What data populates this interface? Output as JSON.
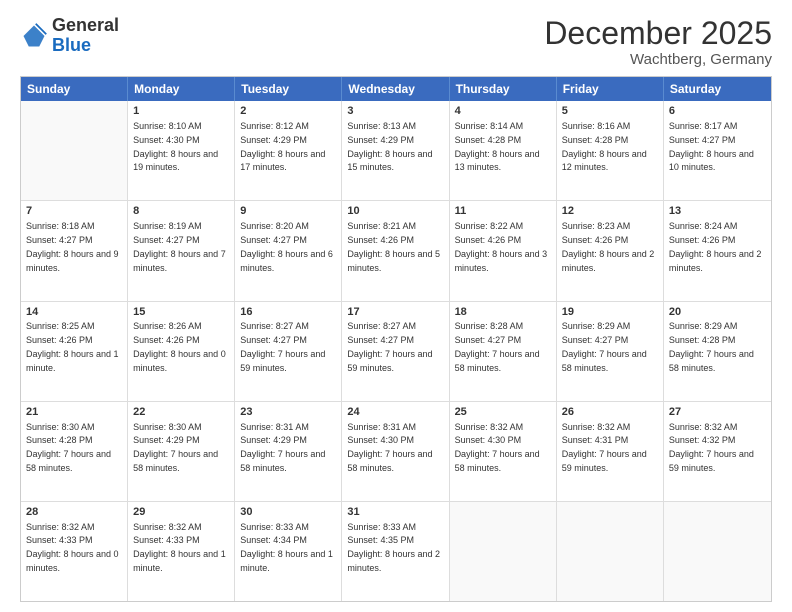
{
  "header": {
    "logo_general": "General",
    "logo_blue": "Blue",
    "month": "December 2025",
    "location": "Wachtberg, Germany"
  },
  "days_of_week": [
    "Sunday",
    "Monday",
    "Tuesday",
    "Wednesday",
    "Thursday",
    "Friday",
    "Saturday"
  ],
  "weeks": [
    [
      {
        "day": "",
        "empty": true
      },
      {
        "day": "1",
        "sunrise": "Sunrise: 8:10 AM",
        "sunset": "Sunset: 4:30 PM",
        "daylight": "Daylight: 8 hours and 19 minutes."
      },
      {
        "day": "2",
        "sunrise": "Sunrise: 8:12 AM",
        "sunset": "Sunset: 4:29 PM",
        "daylight": "Daylight: 8 hours and 17 minutes."
      },
      {
        "day": "3",
        "sunrise": "Sunrise: 8:13 AM",
        "sunset": "Sunset: 4:29 PM",
        "daylight": "Daylight: 8 hours and 15 minutes."
      },
      {
        "day": "4",
        "sunrise": "Sunrise: 8:14 AM",
        "sunset": "Sunset: 4:28 PM",
        "daylight": "Daylight: 8 hours and 13 minutes."
      },
      {
        "day": "5",
        "sunrise": "Sunrise: 8:16 AM",
        "sunset": "Sunset: 4:28 PM",
        "daylight": "Daylight: 8 hours and 12 minutes."
      },
      {
        "day": "6",
        "sunrise": "Sunrise: 8:17 AM",
        "sunset": "Sunset: 4:27 PM",
        "daylight": "Daylight: 8 hours and 10 minutes."
      }
    ],
    [
      {
        "day": "7",
        "sunrise": "Sunrise: 8:18 AM",
        "sunset": "Sunset: 4:27 PM",
        "daylight": "Daylight: 8 hours and 9 minutes."
      },
      {
        "day": "8",
        "sunrise": "Sunrise: 8:19 AM",
        "sunset": "Sunset: 4:27 PM",
        "daylight": "Daylight: 8 hours and 7 minutes."
      },
      {
        "day": "9",
        "sunrise": "Sunrise: 8:20 AM",
        "sunset": "Sunset: 4:27 PM",
        "daylight": "Daylight: 8 hours and 6 minutes."
      },
      {
        "day": "10",
        "sunrise": "Sunrise: 8:21 AM",
        "sunset": "Sunset: 4:26 PM",
        "daylight": "Daylight: 8 hours and 5 minutes."
      },
      {
        "day": "11",
        "sunrise": "Sunrise: 8:22 AM",
        "sunset": "Sunset: 4:26 PM",
        "daylight": "Daylight: 8 hours and 3 minutes."
      },
      {
        "day": "12",
        "sunrise": "Sunrise: 8:23 AM",
        "sunset": "Sunset: 4:26 PM",
        "daylight": "Daylight: 8 hours and 2 minutes."
      },
      {
        "day": "13",
        "sunrise": "Sunrise: 8:24 AM",
        "sunset": "Sunset: 4:26 PM",
        "daylight": "Daylight: 8 hours and 2 minutes."
      }
    ],
    [
      {
        "day": "14",
        "sunrise": "Sunrise: 8:25 AM",
        "sunset": "Sunset: 4:26 PM",
        "daylight": "Daylight: 8 hours and 1 minute."
      },
      {
        "day": "15",
        "sunrise": "Sunrise: 8:26 AM",
        "sunset": "Sunset: 4:26 PM",
        "daylight": "Daylight: 8 hours and 0 minutes."
      },
      {
        "day": "16",
        "sunrise": "Sunrise: 8:27 AM",
        "sunset": "Sunset: 4:27 PM",
        "daylight": "Daylight: 7 hours and 59 minutes."
      },
      {
        "day": "17",
        "sunrise": "Sunrise: 8:27 AM",
        "sunset": "Sunset: 4:27 PM",
        "daylight": "Daylight: 7 hours and 59 minutes."
      },
      {
        "day": "18",
        "sunrise": "Sunrise: 8:28 AM",
        "sunset": "Sunset: 4:27 PM",
        "daylight": "Daylight: 7 hours and 58 minutes."
      },
      {
        "day": "19",
        "sunrise": "Sunrise: 8:29 AM",
        "sunset": "Sunset: 4:27 PM",
        "daylight": "Daylight: 7 hours and 58 minutes."
      },
      {
        "day": "20",
        "sunrise": "Sunrise: 8:29 AM",
        "sunset": "Sunset: 4:28 PM",
        "daylight": "Daylight: 7 hours and 58 minutes."
      }
    ],
    [
      {
        "day": "21",
        "sunrise": "Sunrise: 8:30 AM",
        "sunset": "Sunset: 4:28 PM",
        "daylight": "Daylight: 7 hours and 58 minutes."
      },
      {
        "day": "22",
        "sunrise": "Sunrise: 8:30 AM",
        "sunset": "Sunset: 4:29 PM",
        "daylight": "Daylight: 7 hours and 58 minutes."
      },
      {
        "day": "23",
        "sunrise": "Sunrise: 8:31 AM",
        "sunset": "Sunset: 4:29 PM",
        "daylight": "Daylight: 7 hours and 58 minutes."
      },
      {
        "day": "24",
        "sunrise": "Sunrise: 8:31 AM",
        "sunset": "Sunset: 4:30 PM",
        "daylight": "Daylight: 7 hours and 58 minutes."
      },
      {
        "day": "25",
        "sunrise": "Sunrise: 8:32 AM",
        "sunset": "Sunset: 4:30 PM",
        "daylight": "Daylight: 7 hours and 58 minutes."
      },
      {
        "day": "26",
        "sunrise": "Sunrise: 8:32 AM",
        "sunset": "Sunset: 4:31 PM",
        "daylight": "Daylight: 7 hours and 59 minutes."
      },
      {
        "day": "27",
        "sunrise": "Sunrise: 8:32 AM",
        "sunset": "Sunset: 4:32 PM",
        "daylight": "Daylight: 7 hours and 59 minutes."
      }
    ],
    [
      {
        "day": "28",
        "sunrise": "Sunrise: 8:32 AM",
        "sunset": "Sunset: 4:33 PM",
        "daylight": "Daylight: 8 hours and 0 minutes."
      },
      {
        "day": "29",
        "sunrise": "Sunrise: 8:32 AM",
        "sunset": "Sunset: 4:33 PM",
        "daylight": "Daylight: 8 hours and 1 minute."
      },
      {
        "day": "30",
        "sunrise": "Sunrise: 8:33 AM",
        "sunset": "Sunset: 4:34 PM",
        "daylight": "Daylight: 8 hours and 1 minute."
      },
      {
        "day": "31",
        "sunrise": "Sunrise: 8:33 AM",
        "sunset": "Sunset: 4:35 PM",
        "daylight": "Daylight: 8 hours and 2 minutes."
      },
      {
        "day": "",
        "empty": true
      },
      {
        "day": "",
        "empty": true
      },
      {
        "day": "",
        "empty": true
      }
    ]
  ]
}
